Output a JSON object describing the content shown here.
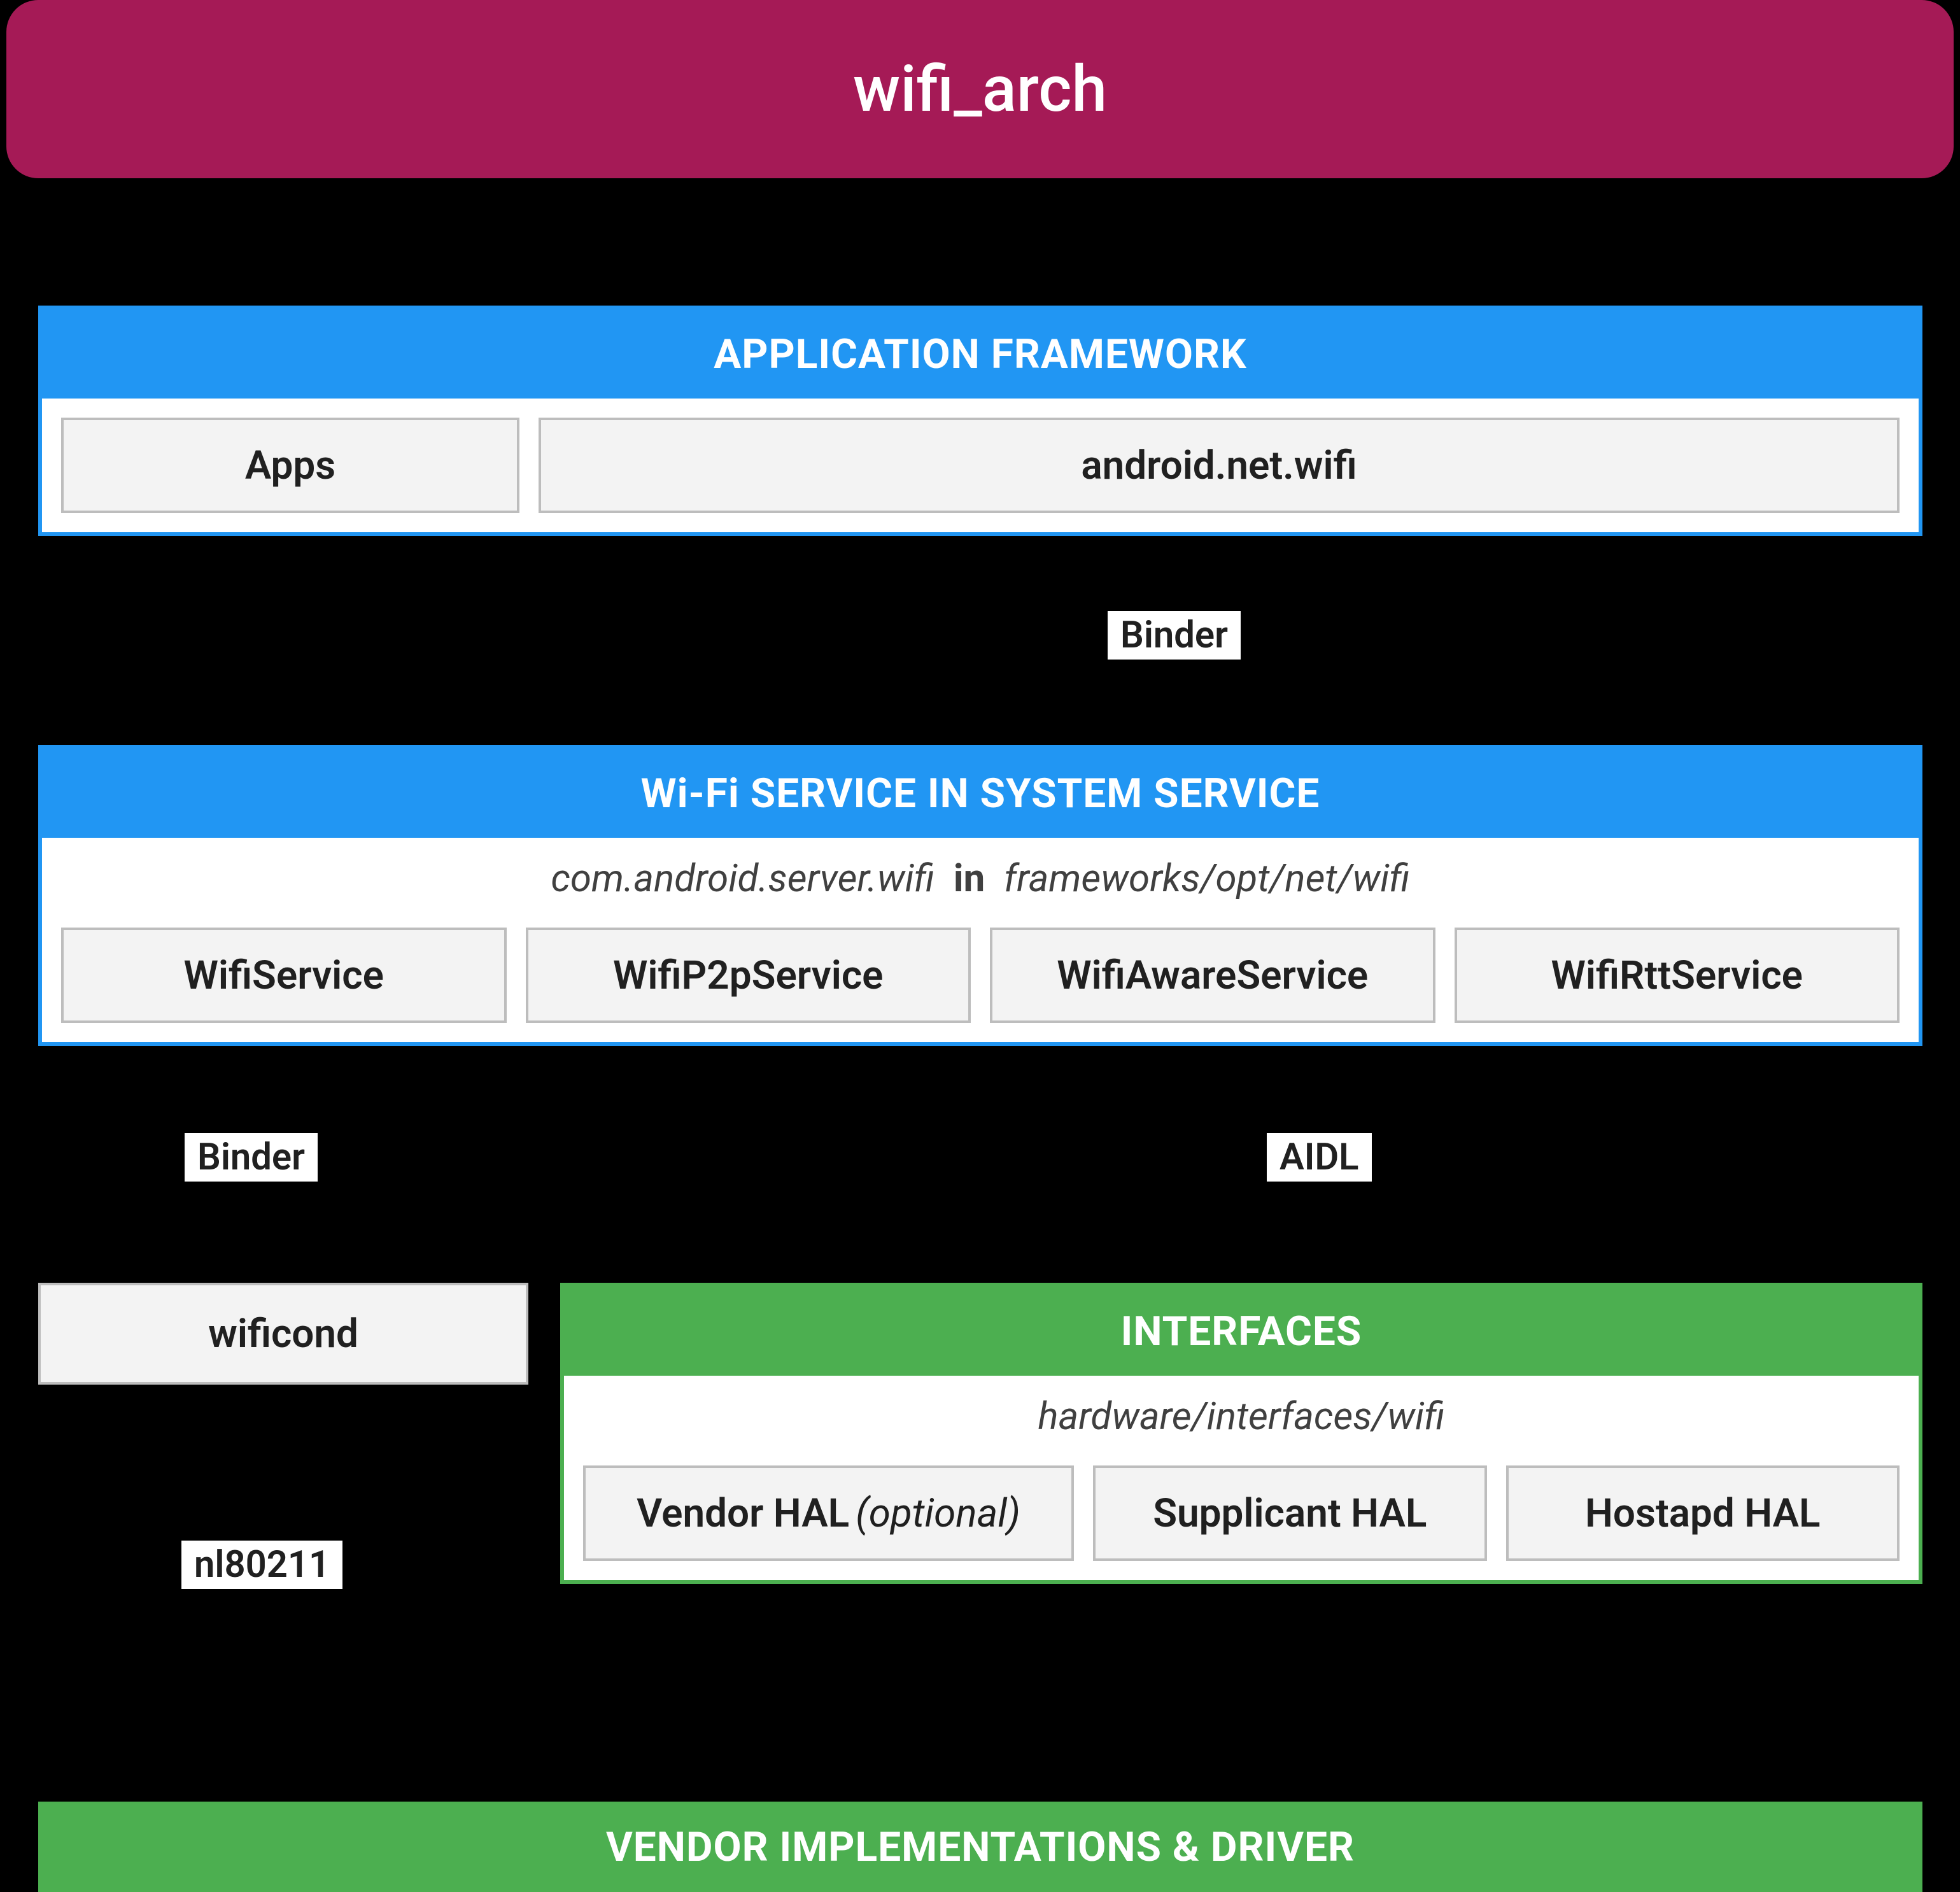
{
  "title": "wifi_arch",
  "layers": {
    "app_framework": {
      "header": "APPLICATION FRAMEWORK",
      "cells": {
        "apps": "Apps",
        "api": "android.net.wifi"
      }
    },
    "wifi_service": {
      "header": "Wi-Fi SERVICE IN SYSTEM SERVICE",
      "subtitle_pkg": "com.android.server.wifi",
      "subtitle_in": "in",
      "subtitle_path": "frameworks/opt/net/wifi",
      "cells": {
        "wifi": "WifiService",
        "p2p": "WifiP2pService",
        "aware": "WifiAwareService",
        "rtt": "WifiRttService"
      }
    },
    "interfaces": {
      "header": "INTERFACES",
      "subtitle": "hardware/interfaces/wifi",
      "cells": {
        "vendor_hal": "Vendor HAL",
        "vendor_hal_opt": "(optional)",
        "supplicant": "Supplicant HAL",
        "hostapd": "Hostapd HAL"
      }
    },
    "vendor": {
      "header": "VENDOR IMPLEMENTATIONS & DRIVER"
    }
  },
  "side": {
    "wificond": "wificond"
  },
  "edges": {
    "binder_top": "Binder",
    "binder_left": "Binder",
    "aidl": "AIDL",
    "nl80211": "nl80211"
  },
  "colors": {
    "title_bg": "#a51a56",
    "blue": "#2196f3",
    "green": "#4caf50",
    "cell_bg": "#f3f3f3",
    "cell_border": "#bdbdbd"
  }
}
